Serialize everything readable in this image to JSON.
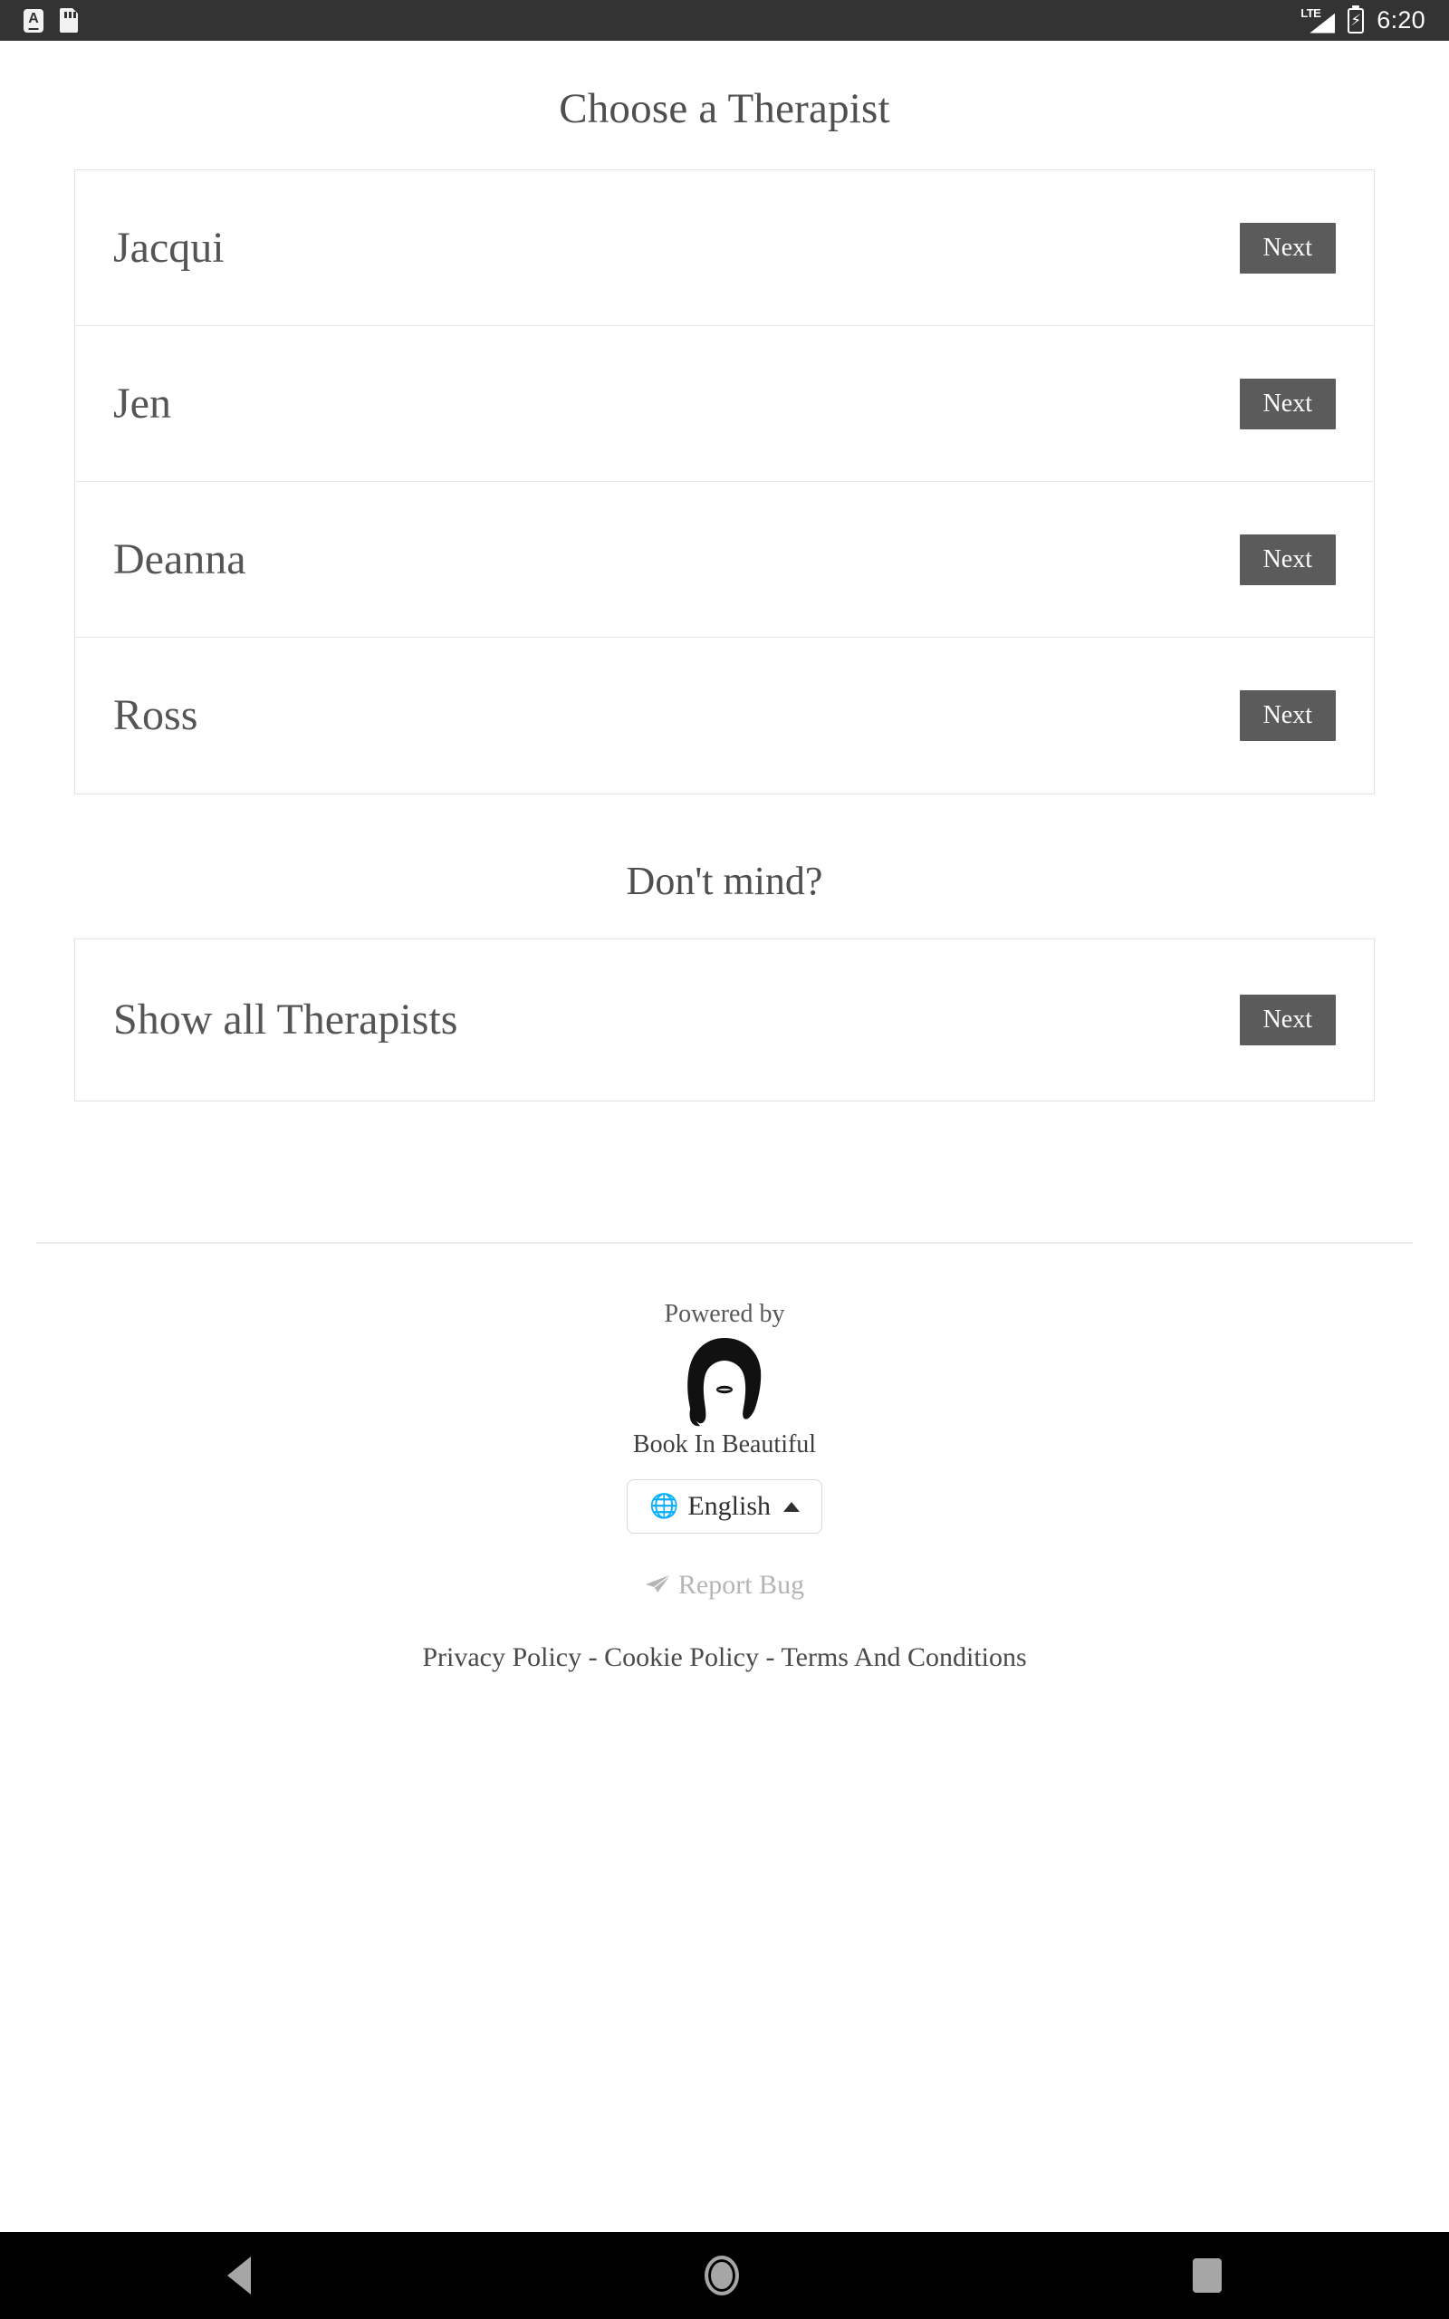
{
  "status_bar": {
    "icons_left": [
      "font-a-icon",
      "sd-card-icon"
    ],
    "network_label": "LTE",
    "battery_state": "charging",
    "time": "6:20"
  },
  "page": {
    "title": "Choose a Therapist",
    "subtitle": "Don't mind?"
  },
  "therapists": [
    {
      "name": "Jacqui",
      "action_label": "Next"
    },
    {
      "name": "Jen",
      "action_label": "Next"
    },
    {
      "name": "Deanna",
      "action_label": "Next"
    },
    {
      "name": "Ross",
      "action_label": "Next"
    }
  ],
  "show_all": {
    "name": "Show all Therapists",
    "action_label": "Next"
  },
  "footer": {
    "powered_by": "Powered by",
    "brand": "Book In Beautiful",
    "logo_icon": "woman-silhouette-logo",
    "language": {
      "icon": "globe-icon",
      "label": "English",
      "caret": "caret-up-icon"
    },
    "report_bug": {
      "icon": "paper-plane-icon",
      "label": "Report Bug"
    },
    "policy_links": [
      "Privacy Policy",
      "Cookie Policy",
      "Terms And Conditions"
    ],
    "policy_separator": "-"
  },
  "nav_bar": {
    "back": "back-icon",
    "home": "home-icon",
    "recents": "recents-icon"
  },
  "colors": {
    "status_bar_bg": "#333333",
    "nav_bar_bg": "#000000",
    "button_bg": "#5b5b5b",
    "text_primary": "#555555",
    "border": "#e2e2e2",
    "muted": "#b5b5b5"
  }
}
